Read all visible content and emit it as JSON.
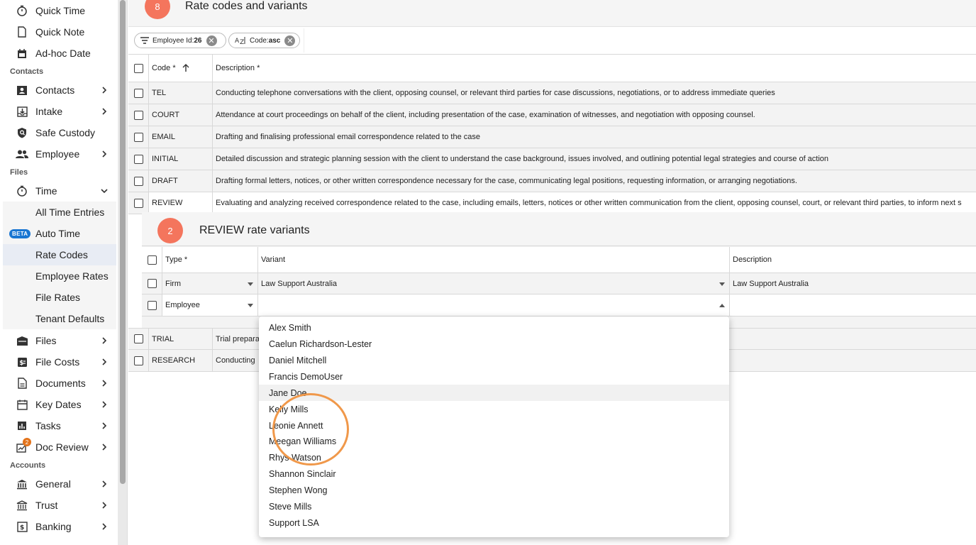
{
  "sidebar": {
    "items": [
      {
        "label": "Quick Time"
      },
      {
        "label": "Quick Note"
      },
      {
        "label": "Ad-hoc Date"
      },
      {
        "label": "Contacts"
      },
      {
        "label": "Intake"
      },
      {
        "label": "Safe Custody"
      },
      {
        "label": "Employee"
      },
      {
        "label": "Time"
      },
      {
        "label": "All Time Entries"
      },
      {
        "label": "Auto Time",
        "badge": "BETA"
      },
      {
        "label": "Rate Codes"
      },
      {
        "label": "Employee Rates"
      },
      {
        "label": "File Rates"
      },
      {
        "label": "Tenant Defaults"
      },
      {
        "label": "Files"
      },
      {
        "label": "File Costs"
      },
      {
        "label": "Documents"
      },
      {
        "label": "Key Dates"
      },
      {
        "label": "Tasks"
      },
      {
        "label": "Doc Review",
        "badge": "2"
      },
      {
        "label": "General"
      },
      {
        "label": "Trust"
      },
      {
        "label": "Banking"
      }
    ],
    "sections": {
      "contacts": "Contacts",
      "files": "Files",
      "accounts": "Accounts"
    }
  },
  "panel": {
    "step": "8",
    "title": "Rate codes and variants"
  },
  "filters": [
    {
      "prefix": "Employee Id:",
      "value": "26"
    },
    {
      "prefix": "Code:",
      "value": "asc"
    }
  ],
  "table": {
    "headers": {
      "code": "Code *",
      "description": "Description *"
    },
    "rows": [
      {
        "code": "TEL",
        "description": "Conducting telephone conversations with the client, opposing counsel, or relevant third parties for case discussions, negotiations, or to address immediate queries"
      },
      {
        "code": "COURT",
        "description": "Attendance at court proceedings on behalf of the client, including presentation of the case, examination of witnesses, and negotiation with opposing counsel."
      },
      {
        "code": "EMAIL",
        "description": "Drafting and finalising professional email correspondence related to the case"
      },
      {
        "code": "INITIAL",
        "description": "Detailed discussion and strategic planning session with the client to understand the case background, issues involved, and outlining potential legal strategies and course of action"
      },
      {
        "code": "DRAFT",
        "description": "Drafting formal letters, notices, or other written correspondence necessary for the case, communicating legal positions, requesting information, or arranging negotiations."
      },
      {
        "code": "REVIEW",
        "description": "Evaluating and analyzing received correspondence related to the case, including emails, letters, notices or other written communication from the client, opposing counsel, court, or relevant third parties, to inform next s"
      },
      {
        "code": "TRIAL",
        "description": "Trial prepara"
      },
      {
        "code": "RESEARCH",
        "description": "Conducting"
      }
    ]
  },
  "variants": {
    "step": "2",
    "title": "REVIEW rate variants",
    "headers": {
      "type": "Type *",
      "variant": "Variant",
      "description": "Description"
    },
    "rows": [
      {
        "type": "Firm",
        "variant": "Law Support Australia",
        "description": "Law Support Australia"
      },
      {
        "type": "Employee",
        "variant": "",
        "description": ""
      }
    ]
  },
  "dropdown": {
    "options": [
      "Alex Smith",
      "Caelun Richardson-Lester",
      "Daniel Mitchell",
      "Francis DemoUser",
      "Jane Doe",
      "Kelly Mills",
      "Leonie Annett",
      "Meegan Williams",
      "Rhys Watson",
      "Shannon Sinclair",
      "Stephen Wong",
      "Steve Mills",
      "Support LSA"
    ],
    "hovered": "Jane Doe"
  },
  "colors": {
    "accent_step": "#f4755d",
    "highlight_ring": "#f0984a",
    "beta_badge": "#1976d2",
    "notif_badge": "#e3731a"
  }
}
